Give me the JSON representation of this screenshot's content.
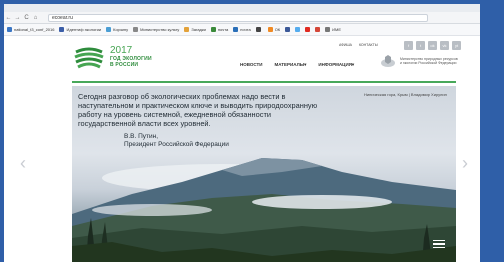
{
  "browser": {
    "nav": [
      "←",
      "→",
      "C",
      "⌂"
    ],
    "url": "ecoear.ru",
    "bookmarks": [
      "national_t3_conf_2016",
      "Идентиф экологии",
      "Корзину",
      "Министерство культу",
      "Загадки",
      "почта",
      "почта",
      "",
      "ОК",
      "",
      "",
      "",
      "",
      "ИМЕ"
    ]
  },
  "site": {
    "logo": {
      "year": "2017",
      "line1": "ГОД ЭКОЛОГИИ",
      "line2": "В РОССИИ"
    },
    "top_menu": [
      "АФИША",
      "КОНТАКТЫ"
    ],
    "main_menu": [
      "НОВОСТИ",
      "МАТЕРИАЛЫ▾",
      "ИНФОРМАЦИЯ▾"
    ],
    "ministry": "Министерство природных ресурсов и экологии Российской Федерации",
    "social": [
      "f",
      "t",
      "ok",
      "vk",
      "yt"
    ],
    "accent": "#46a552"
  },
  "hero": {
    "quote": "Сегодня разговор об экологических проблемах надо вести в наступательном и практическом ключе и выводить природоохранную работу на уровень системной, ежедневной обязанности государственной власти всех уровней.",
    "author_name": "В.В. Путин,",
    "author_title": "Президент Российской Федерации",
    "caption": "Ниническая гора, Крым | Владимир Хирулин"
  },
  "arrows": {
    "prev": "‹",
    "next": "›"
  }
}
